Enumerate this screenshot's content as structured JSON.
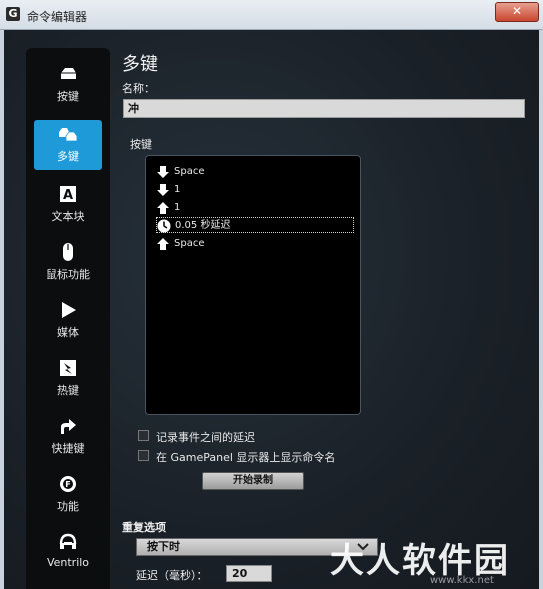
{
  "window": {
    "title": "命令编辑器",
    "close_label": "✕"
  },
  "sidebar": {
    "items": [
      {
        "label": "按键",
        "icon": "key-icon"
      },
      {
        "label": "多键",
        "icon": "multikey-icon",
        "active": true
      },
      {
        "label": "文本块",
        "icon": "text-block-icon"
      },
      {
        "label": "鼠标功能",
        "icon": "mouse-icon"
      },
      {
        "label": "媒体",
        "icon": "play-icon"
      },
      {
        "label": "热键",
        "icon": "hotkey-icon"
      },
      {
        "label": "快捷键",
        "icon": "shortcut-arrow-icon"
      },
      {
        "label": "功能",
        "icon": "function-gear-icon"
      },
      {
        "label": "Ventrilo",
        "icon": "headset-icon"
      }
    ]
  },
  "content": {
    "heading": "多键",
    "name_label": "名称：",
    "name_value": "冲",
    "keys_label": "按键",
    "keys": [
      {
        "icon": "key-down-arrow-icon",
        "text": "Space"
      },
      {
        "icon": "key-down-arrow-icon",
        "text": "1"
      },
      {
        "icon": "key-up-arrow-icon",
        "text": "1"
      },
      {
        "icon": "clock-icon",
        "text": "0.05 秒延迟",
        "selected": true
      },
      {
        "icon": "key-up-arrow-icon",
        "text": "Space"
      }
    ],
    "checkbox_record_delay": "记录事件之间的延迟",
    "checkbox_gamepanel": "在 GamePanel 显示器上显示命令名",
    "record_button": "开始录制",
    "repeat_label": "重复选项",
    "repeat_select_value": "按下时",
    "delay_label": "延迟（毫秒）：",
    "delay_value": "20"
  },
  "watermark": {
    "text": "大人软件园",
    "url": "www.kkx.net"
  },
  "colors": {
    "accent": "#1f9ad8",
    "background": "#1b2128",
    "sidebar": "#0b0d0f"
  }
}
